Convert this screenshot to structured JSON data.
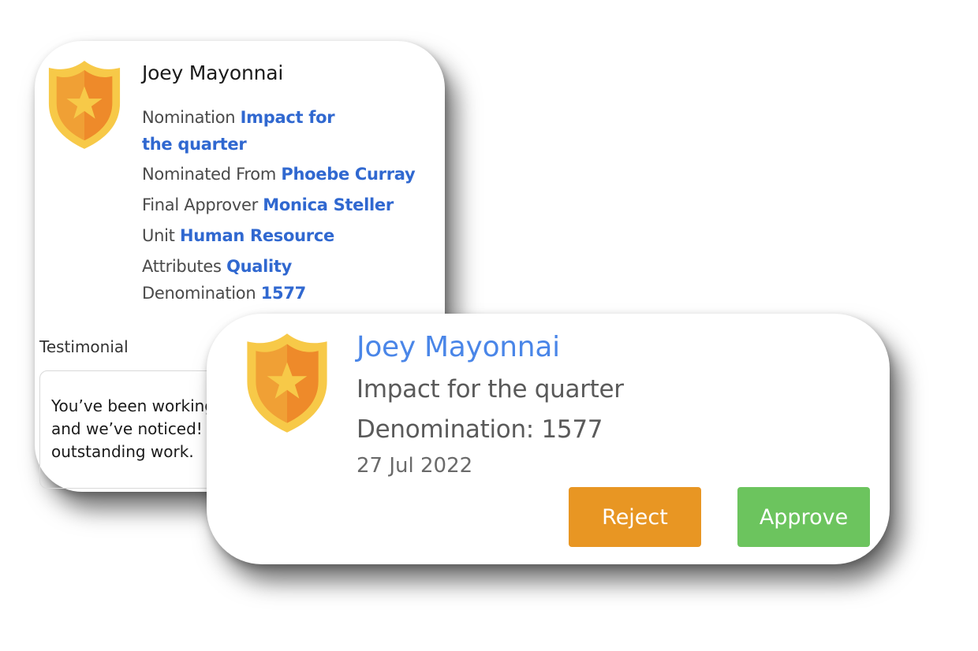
{
  "colors": {
    "link": "#3068d0",
    "name_accent": "#4a86e8",
    "reject": "#e89623",
    "approve": "#6cc45e",
    "shield_outer": "#f7c948",
    "shield_inner": "#f29a2e"
  },
  "icons": {
    "badge": "shield-star-icon"
  },
  "detail": {
    "name": "Joey Mayonnai",
    "nomination": {
      "label": "Nomination",
      "value": "Impact for the quarter"
    },
    "nominated_from": {
      "label": "Nominated From",
      "value": "Phoebe Curray"
    },
    "final_approver": {
      "label": "Final Approver",
      "value": "Monica Steller"
    },
    "unit": {
      "label": "Unit",
      "value": "Human Resource"
    },
    "attributes": {
      "label": "Attributes",
      "value": "Quality"
    },
    "denomination": {
      "label": "Denomination",
      "value": "1577"
    },
    "testimonial_label": "Testimonial",
    "testimonial_text": "You’ve been working\nand we’ve noticed! G\noutstanding work."
  },
  "summary": {
    "name": "Joey Mayonnai",
    "nomination": "Impact for the quarter",
    "denomination": "Denomination: 1577",
    "date": "27 Jul 2022",
    "reject_label": "Reject",
    "approve_label": "Approve"
  }
}
